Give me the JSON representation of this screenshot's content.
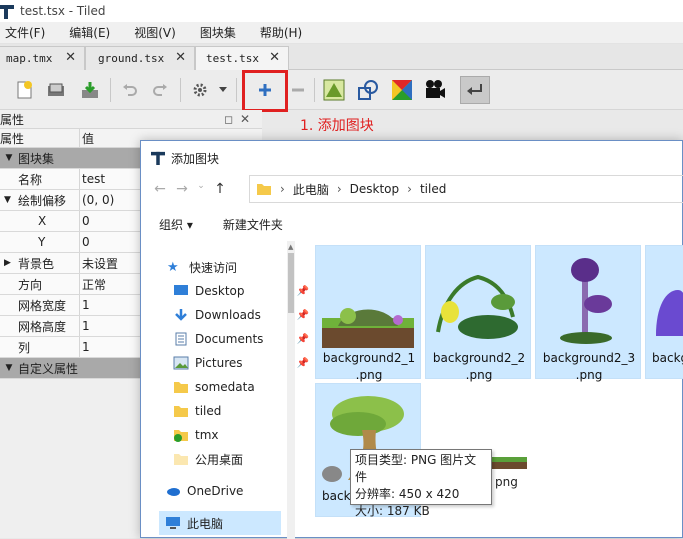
{
  "window": {
    "title": "test.tsx - Tiled"
  },
  "menu": [
    "文件(F)",
    "编辑(E)",
    "视图(V)",
    "图块集",
    "帮助(H)"
  ],
  "tabs": [
    {
      "label": "map.tmx"
    },
    {
      "label": "ground.tsx"
    },
    {
      "label": "test.tsx",
      "active": true
    }
  ],
  "annotation": "1. 添加图块",
  "props": {
    "panel_title": "属性",
    "col_name": "属性",
    "col_value": "值",
    "group_tileset": "图块集",
    "rows": [
      {
        "k": "名称",
        "v": "test"
      },
      {
        "k": "绘制偏移",
        "v": "(0, 0)"
      },
      {
        "k": "X",
        "v": "0"
      },
      {
        "k": "Y",
        "v": "0"
      },
      {
        "k": "背景色",
        "v": "未设置"
      },
      {
        "k": "方向",
        "v": "正常"
      },
      {
        "k": "网格宽度",
        "v": "1"
      },
      {
        "k": "网格高度",
        "v": "1"
      },
      {
        "k": "列",
        "v": "1"
      }
    ],
    "group_custom": "自定义属性"
  },
  "dialog": {
    "title": "添加图块",
    "breadcrumb": [
      "此电脑",
      "Desktop",
      "tiled"
    ],
    "organize": "组织 ▾",
    "new_folder": "新建文件夹",
    "nav": {
      "quick": "快速访问",
      "items": [
        "Desktop",
        "Downloads",
        "Documents",
        "Pictures",
        "somedata",
        "tiled",
        "tmx",
        "公用桌面"
      ],
      "onedrive": "OneDrive",
      "thispc": "此电脑"
    },
    "files": [
      {
        "name": "background2_1\n.png"
      },
      {
        "name": "background2_2\n.png"
      },
      {
        "name": "background2_3\n.png"
      },
      {
        "name": "backg"
      },
      {
        "name": "back"
      },
      {
        "name": "png"
      }
    ],
    "tooltip": [
      "项目类型: PNG 图片文件",
      "分辨率: 450 x 420",
      "大小: 187 KB"
    ]
  },
  "colors": {
    "accent": "#e02020",
    "selection": "#cce8ff",
    "folder": "#f5c94a"
  }
}
